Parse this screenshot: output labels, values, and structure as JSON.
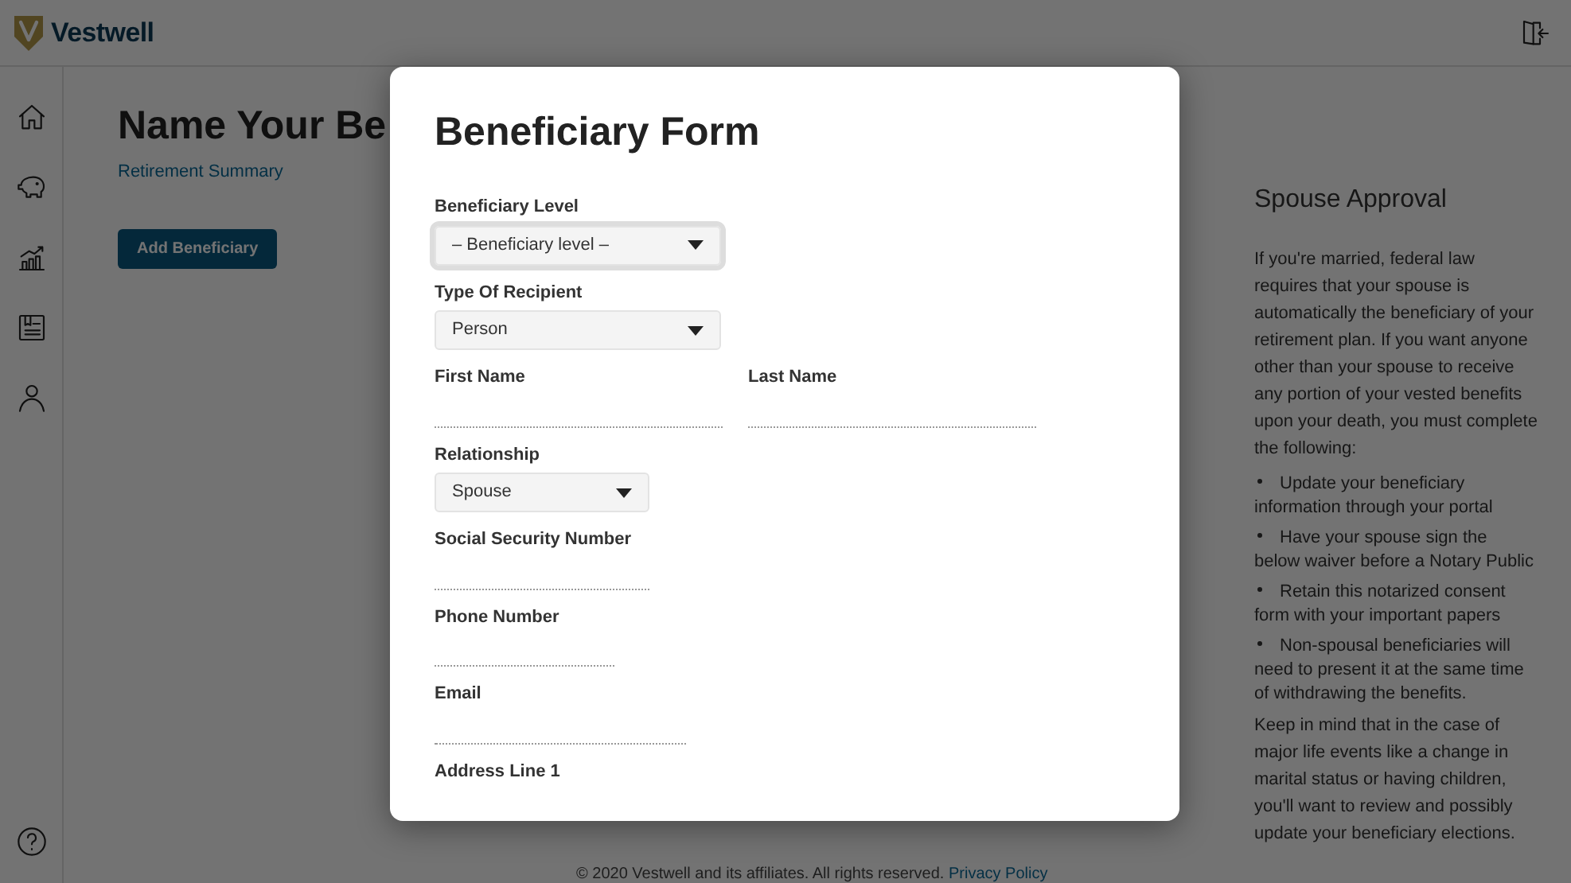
{
  "header": {
    "logo_text": "Vestwell"
  },
  "page": {
    "title": "Name Your Be",
    "breadcrumb": "Retirement Summary",
    "add_button": "Add Beneficiary"
  },
  "modal": {
    "title": "Beneficiary Form",
    "rows": [
      [
        {
          "kind": "select",
          "label": "Beneficiary Level",
          "value": "– Beneficiary level –",
          "focused": true
        }
      ],
      [
        {
          "kind": "select",
          "label": "Type Of Recipient",
          "value": "Person",
          "focused": false
        }
      ],
      [
        {
          "kind": "text",
          "label": "First Name"
        },
        {
          "kind": "text",
          "label": "Last Name"
        }
      ],
      [
        {
          "kind": "select",
          "label": "Relationship",
          "value": "Spouse",
          "focused": false
        }
      ],
      [
        {
          "kind": "text",
          "label": "Social Security Number"
        }
      ],
      [
        {
          "kind": "text",
          "label": "Phone Number"
        }
      ],
      [
        {
          "kind": "text",
          "label": "Email"
        }
      ],
      [
        {
          "kind": "label",
          "label": "Address Line 1"
        }
      ]
    ]
  },
  "side_panel": {
    "title": "Spouse Approval",
    "intro": "If you're married, federal law requires that your spouse is automatically the beneficiary of your retirement plan. If you want anyone other than your spouse to receive any portion of your vested benefits upon your death, you must complete the following:",
    "bullets": [
      "Update your beneficiary information through your portal",
      "Have your spouse sign the below waiver before a Notary Public",
      "Retain this notarized consent form with your important papers",
      "Non-spousal beneficiaries will need to present it at the same time of withdrawing the benefits."
    ],
    "closing": "Keep in mind that in the case of major life events like a change in marital status or having children, you'll want to review and possibly update your beneficiary elections."
  },
  "footer": {
    "text": "© 2020 Vestwell and its affiliates. All rights reserved.",
    "link": "Privacy Policy"
  }
}
